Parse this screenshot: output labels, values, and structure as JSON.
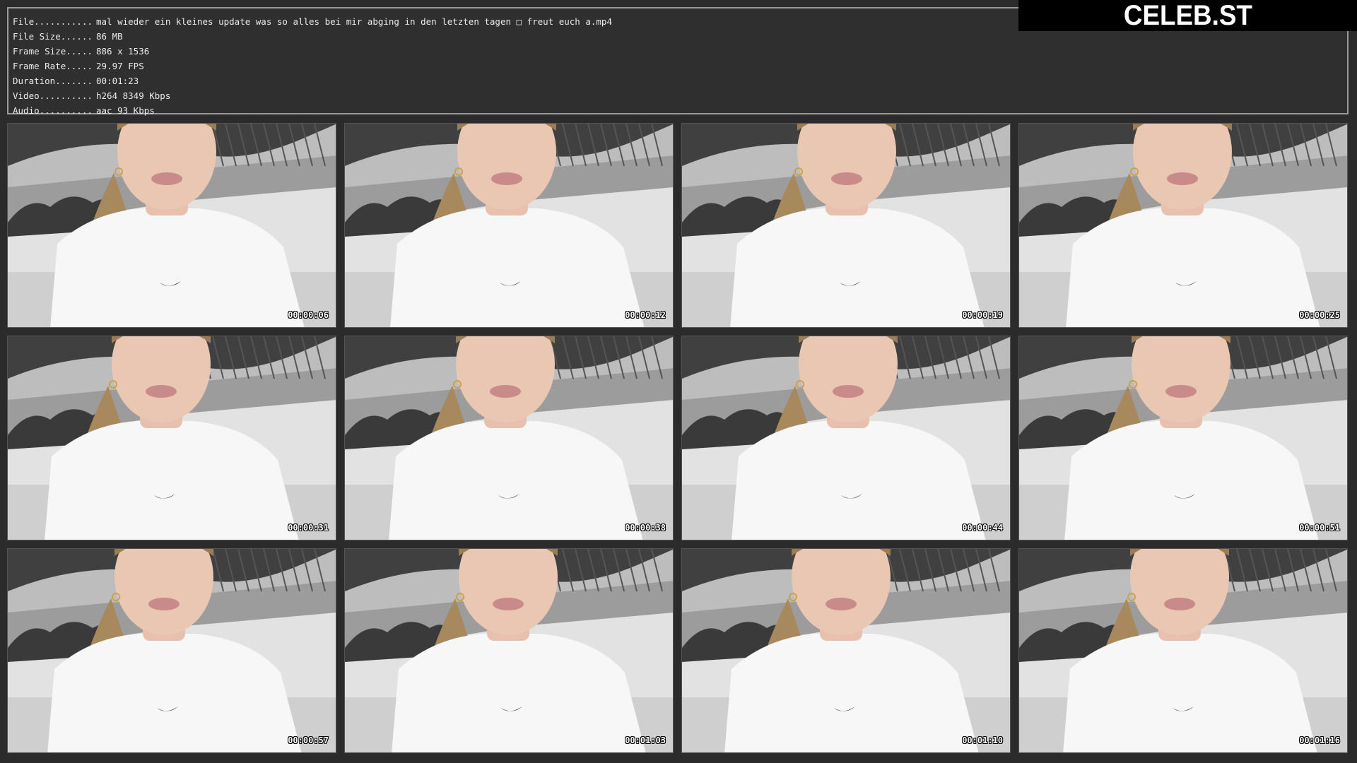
{
  "info": {
    "rows": [
      {
        "key": "File...........",
        "value": "mal wieder ein kleines update was so alles bei mir abging in den letzten tagen □  freut euch a.mp4"
      },
      {
        "key": "File Size......",
        "value": "86 MB"
      },
      {
        "key": "Frame Size.....",
        "value": "886 x 1536"
      },
      {
        "key": "Frame Rate.....",
        "value": "29.97 FPS"
      },
      {
        "key": "Duration.......",
        "value": "00:01:23"
      },
      {
        "key": "Video..........",
        "value": "h264 8349 Kbps"
      },
      {
        "key": "Audio..........",
        "value": "aac 93 Kbps"
      }
    ]
  },
  "brand": {
    "text": "CELEB.ST"
  },
  "thumbnails": [
    {
      "timestamp": "00:00:06"
    },
    {
      "timestamp": "00:00:12"
    },
    {
      "timestamp": "00:00:19"
    },
    {
      "timestamp": "00:00:25"
    },
    {
      "timestamp": "00:00:31"
    },
    {
      "timestamp": "00:00:38"
    },
    {
      "timestamp": "00:00:44"
    },
    {
      "timestamp": "00:00:51"
    },
    {
      "timestamp": "00:00:57"
    },
    {
      "timestamp": "00:01:03"
    },
    {
      "timestamp": "00:01:10"
    },
    {
      "timestamp": "00:01:16"
    }
  ]
}
